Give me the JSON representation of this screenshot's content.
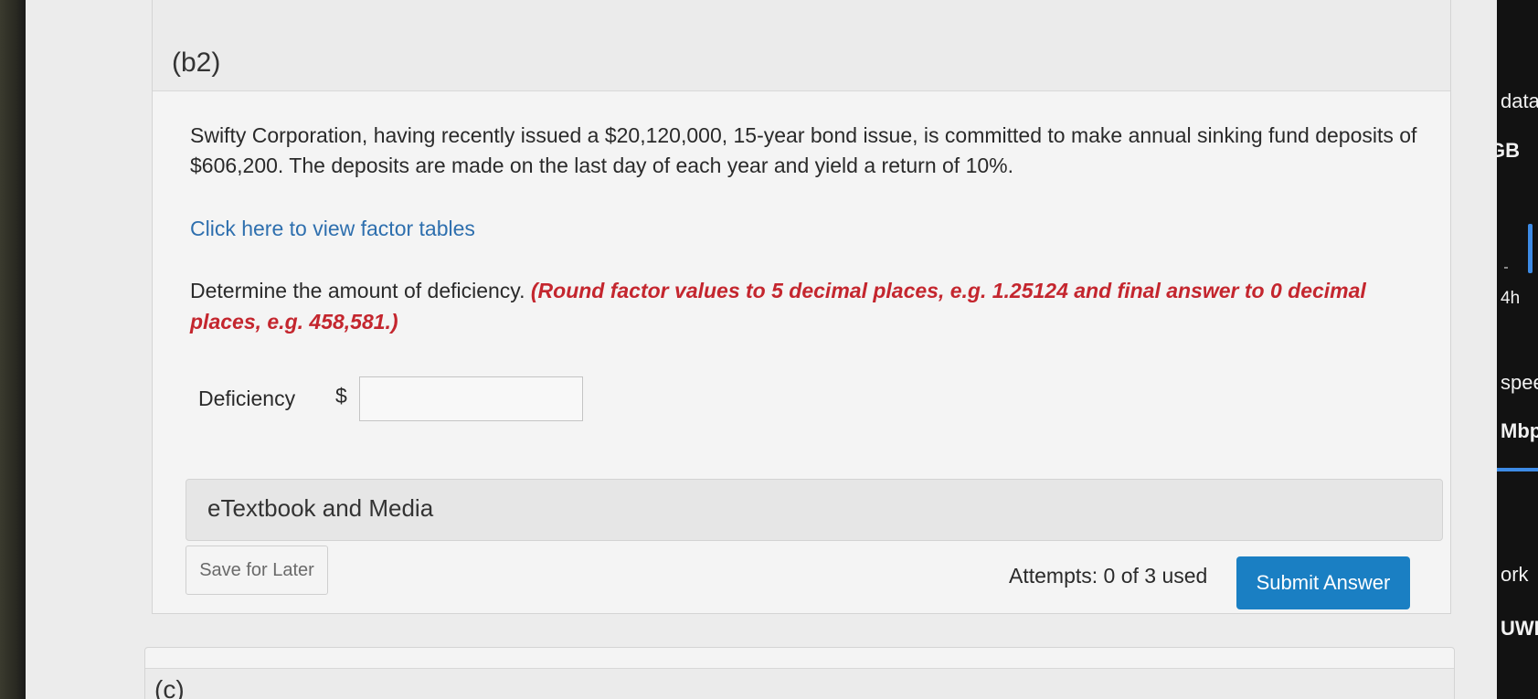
{
  "question": {
    "part_label": "(b2)",
    "problem_text": "Swifty Corporation, having recently issued a $20,120,000, 15-year bond issue, is committed to make annual sinking fund deposits of $606,200. The deposits are made on the last day of each year and yield a return of 10%.",
    "factor_link": "Click here to view factor tables",
    "instruction_lead": "Determine the amount of deficiency.",
    "instruction_emphasis": "(Round factor values to 5 decimal places, e.g. 1.25124 and final answer to 0 decimal places, e.g. 458,581.)",
    "answer_label": "Deficiency",
    "currency_symbol": "$",
    "answer_value": "",
    "etextbook_label": "eTextbook and Media",
    "save_label": "Save for Later",
    "attempts_text": "Attempts: 0 of 3 used",
    "submit_label": "Submit Answer"
  },
  "next_part": {
    "label": "(c)"
  },
  "side_panel": {
    "items": [
      "data",
      "GB",
      "4h",
      "spee",
      "Mbp",
      "ork",
      "UWI"
    ]
  },
  "colors": {
    "link": "#2e6fae",
    "emphasis": "#c4262e",
    "submit": "#1a7fc3"
  }
}
